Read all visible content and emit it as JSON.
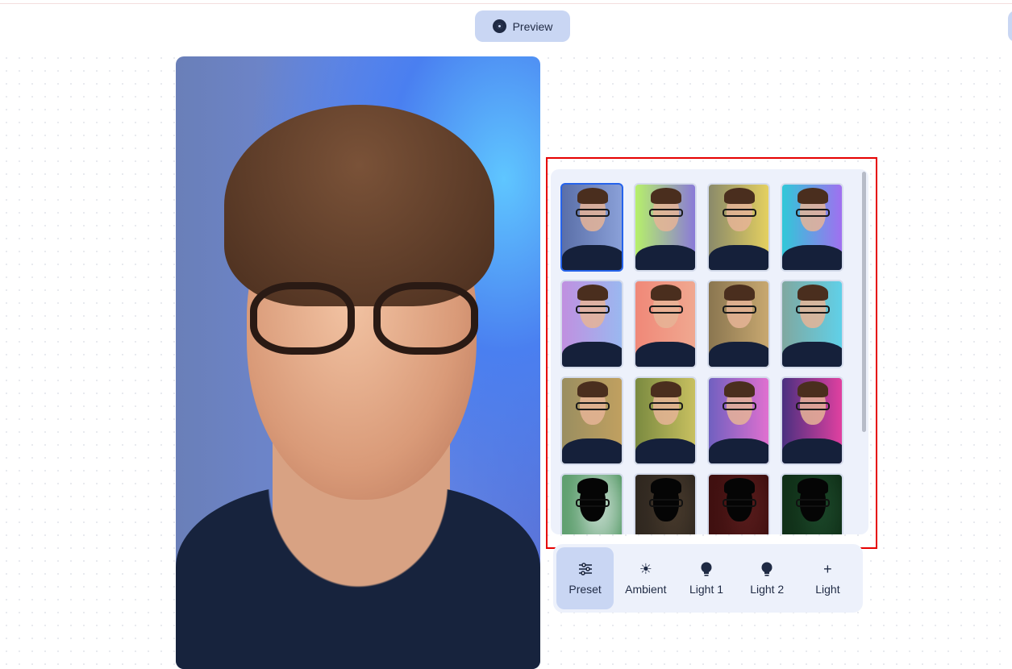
{
  "header": {
    "preview_label": "Preview"
  },
  "presets": [
    {
      "colors": [
        "#5a6fa8",
        "#8aa0d8"
      ],
      "selected": true
    },
    {
      "colors": [
        "#b6f06a",
        "#8a7ad8"
      ]
    },
    {
      "colors": [
        "#8a8a6a",
        "#e4d060"
      ]
    },
    {
      "colors": [
        "#30c8d8",
        "#a070f0"
      ]
    },
    {
      "colors": [
        "#c090e0",
        "#9ab8f0"
      ]
    },
    {
      "colors": [
        "#f08878",
        "#f0a890"
      ]
    },
    {
      "colors": [
        "#8a7650",
        "#c8a870"
      ]
    },
    {
      "colors": [
        "#80a8a0",
        "#60d0e8"
      ]
    },
    {
      "colors": [
        "#9a8e60",
        "#c0a060"
      ]
    },
    {
      "colors": [
        "#7a8a40",
        "#c8c060"
      ]
    },
    {
      "colors": [
        "#7060c0",
        "#e070d0"
      ]
    },
    {
      "colors": [
        "#4a3080",
        "#e040a0"
      ]
    },
    {
      "colors": [
        "#60a070",
        "#e8f0f0"
      ],
      "dark": true
    },
    {
      "colors": [
        "#302820",
        "#504030"
      ],
      "dark": true
    },
    {
      "colors": [
        "#401010",
        "#602020"
      ],
      "dark": true
    },
    {
      "colors": [
        "#103018",
        "#205030"
      ],
      "dark": true
    }
  ],
  "toolbar": [
    {
      "label": "Preset",
      "icon": "sliders-icon",
      "active": true
    },
    {
      "label": "Ambient",
      "icon": "sun-icon"
    },
    {
      "label": "Light 1",
      "icon": "bulb-icon"
    },
    {
      "label": "Light 2",
      "icon": "bulb-icon"
    },
    {
      "label": "Light",
      "icon": "plus-icon"
    }
  ],
  "accent": "#2563eb"
}
